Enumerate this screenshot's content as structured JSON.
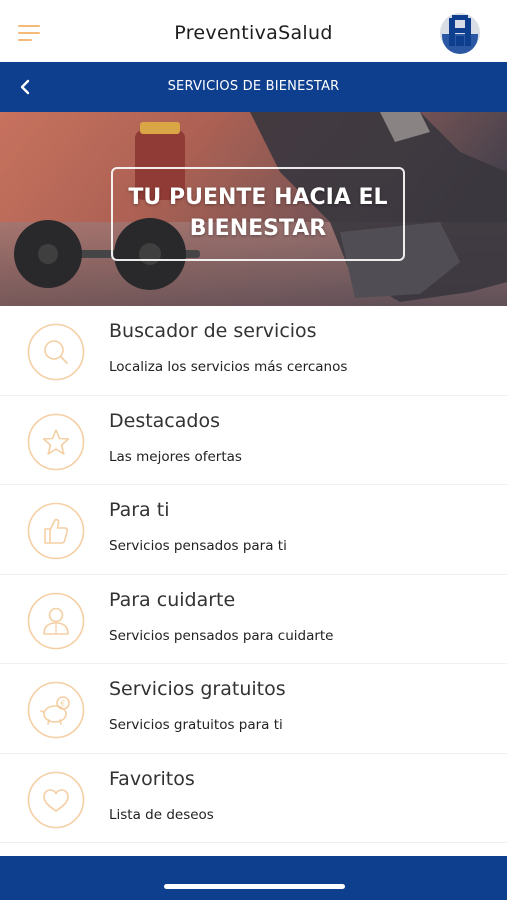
{
  "header": {
    "app_title": "PreventivaSalud",
    "menu_icon": "hamburger-menu-icon",
    "logo_icon": "insurer-logo-icon"
  },
  "navbar": {
    "title": "SERVICIOS DE BIENESTAR",
    "back_icon": "chevron-left-icon"
  },
  "hero": {
    "line1": "TU PUENTE HACIA EL",
    "line2": "BIENESTAR"
  },
  "services": [
    {
      "title": "Buscador de servicios",
      "subtitle": "Localiza los servicios más cercanos",
      "icon": "search-icon"
    },
    {
      "title": "Destacados",
      "subtitle": "Las mejores ofertas",
      "icon": "star-icon"
    },
    {
      "title": "Para ti",
      "subtitle": "Servicios pensados para ti",
      "icon": "thumbs-up-icon"
    },
    {
      "title": "Para cuidarte",
      "subtitle": "Servicios pensados para cuidarte",
      "icon": "person-icon"
    },
    {
      "title": "Servicios gratuitos",
      "subtitle": "Servicios gratuitos para ti",
      "icon": "piggy-bank-icon"
    },
    {
      "title": "Favoritos",
      "subtitle": "Lista de deseos",
      "icon": "heart-icon"
    }
  ],
  "colors": {
    "primary_blue": "#0e3f8e",
    "accent_orange": "#f5b979"
  }
}
